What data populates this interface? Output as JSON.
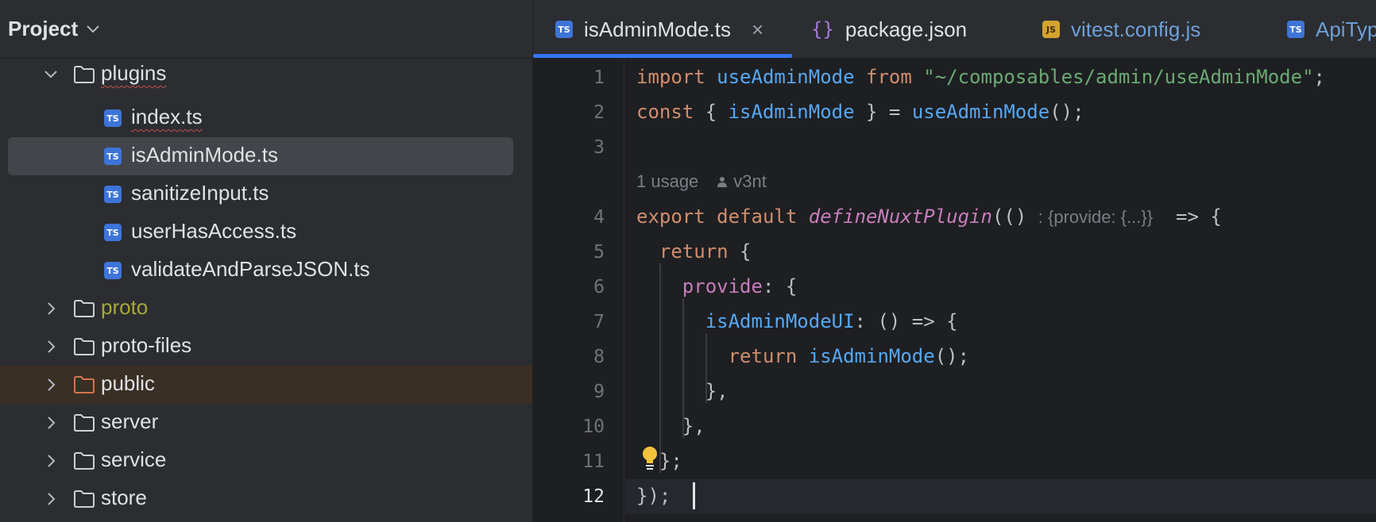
{
  "panel": {
    "title": "Project",
    "tree": [
      {
        "label": "plugins",
        "type": "folder",
        "state": "expanded",
        "squiggle": true
      },
      {
        "label": "index.ts",
        "type": "ts-file",
        "squiggle": true
      },
      {
        "label": "isAdminMode.ts",
        "type": "ts-file",
        "selected": true
      },
      {
        "label": "sanitizeInput.ts",
        "type": "ts-file"
      },
      {
        "label": "userHasAccess.ts",
        "type": "ts-file"
      },
      {
        "label": "validateAndParseJSON.ts",
        "type": "ts-file"
      },
      {
        "label": "proto",
        "type": "folder",
        "state": "collapsed",
        "color": "#a8a834"
      },
      {
        "label": "proto-files",
        "type": "folder",
        "state": "collapsed"
      },
      {
        "label": "public",
        "type": "folder",
        "state": "collapsed",
        "highlight": true,
        "folder_color": "#d4744f"
      },
      {
        "label": "server",
        "type": "folder",
        "state": "collapsed"
      },
      {
        "label": "service",
        "type": "folder",
        "state": "collapsed"
      },
      {
        "label": "store",
        "type": "folder",
        "state": "collapsed"
      }
    ]
  },
  "tabs": [
    {
      "label": "isAdminMode.ts",
      "icon": "ts-icon",
      "active": true,
      "icon_text": "TS"
    },
    {
      "label": "package.json",
      "icon": "json-braces-icon",
      "icon_text": "{}"
    },
    {
      "label": "vitest.config.js",
      "icon": "js-icon",
      "icon_text": "JS"
    },
    {
      "label": "ApiTyp",
      "icon": "ts-icon",
      "icon_text": "TS"
    }
  ],
  "editor": {
    "current_line": 12,
    "line_numbers": [
      "1",
      "2",
      "3",
      "4",
      "5",
      "6",
      "7",
      "8",
      "9",
      "10",
      "11",
      "12"
    ],
    "code": {
      "l1_import": "import",
      "l1_name": "useAdminMode",
      "l1_from": "from",
      "l1_path": "\"~/composables/admin/useAdminMode\"",
      "l1_semi": ";",
      "l2_const": "const",
      "l2_open": "{ ",
      "l2_name": "isAdminMode",
      "l2_mid": " } = ",
      "l2_call": "useAdminMode",
      "l2_end": "();",
      "hint_usage": "1 usage",
      "hint_author": "v3nt",
      "l4_export": "export",
      "l4_default": "default",
      "l4_fn": "defineNuxtPlugin",
      "l4_paren": "(()",
      "l4_hint": ": {provide: {...}}",
      "l4_arrow": "=> {",
      "l5_return": "return",
      "l5_brace": " {",
      "l6_provide": "provide",
      "l6_rest": ": {",
      "l7_name": "isAdminModeUI",
      "l7_rest": ": () => {",
      "l8_return": "return",
      "l8_call": "isAdminMode",
      "l8_end": "();",
      "l9": "},",
      "l10": "},",
      "l11": "};",
      "l12": "});"
    }
  },
  "colors": {
    "keyword": "#cf8e6d",
    "function": "#56a8f5",
    "string": "#6aab73",
    "property": "#c77dbb",
    "accent": "#3574f0"
  }
}
